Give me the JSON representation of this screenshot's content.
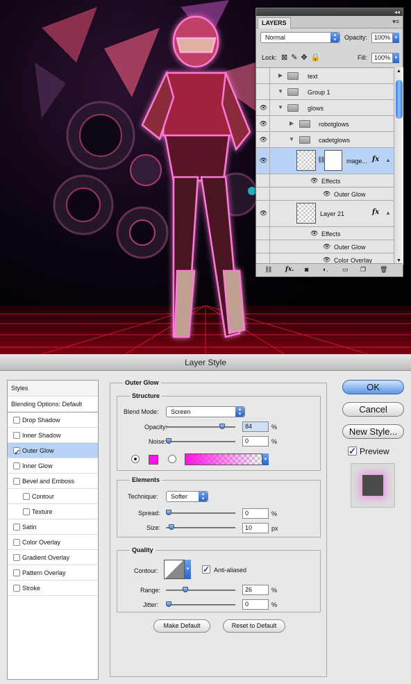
{
  "layers_panel": {
    "collapse_glyph": "◂◂",
    "tab": "LAYERS",
    "blend_mode": "Normal",
    "opacity_label": "Opacity:",
    "opacity_value": "100%",
    "lock_label": "Lock:",
    "fill_label": "Fill:",
    "fill_value": "100%",
    "rows": [
      {
        "name": "text",
        "visible": false
      },
      {
        "name": "Group 1",
        "visible": false
      },
      {
        "name": "glows",
        "visible": true
      },
      {
        "name": "robotglows",
        "visible": true
      },
      {
        "name": "cadetglows",
        "visible": true
      },
      {
        "name": "mage...",
        "visible": true,
        "fx": "fx"
      },
      {
        "name": "Effects"
      },
      {
        "name": "Outer Glow"
      },
      {
        "name": "Layer 21",
        "visible": true,
        "fx": "fx"
      },
      {
        "name": "Effects"
      },
      {
        "name": "Outer Glow"
      },
      {
        "name": "Color Overlay"
      }
    ]
  },
  "dialog": {
    "title": "Layer Style",
    "styles_header": "Styles",
    "blending_options": "Blending Options: Default",
    "styles": [
      {
        "label": "Drop Shadow",
        "checked": false
      },
      {
        "label": "Inner Shadow",
        "checked": false
      },
      {
        "label": "Outer Glow",
        "checked": true
      },
      {
        "label": "Inner Glow",
        "checked": false
      },
      {
        "label": "Bevel and Emboss",
        "checked": false
      },
      {
        "label": "Contour",
        "checked": false
      },
      {
        "label": "Texture",
        "checked": false
      },
      {
        "label": "Satin",
        "checked": false
      },
      {
        "label": "Color Overlay",
        "checked": false
      },
      {
        "label": "Gradient Overlay",
        "checked": false
      },
      {
        "label": "Pattern Overlay",
        "checked": false
      },
      {
        "label": "Stroke",
        "checked": false
      }
    ],
    "section_title": "Outer Glow",
    "structure": {
      "title": "Structure",
      "blend_mode_label": "Blend Mode:",
      "blend_mode": "Screen",
      "opacity_label": "Opacity:",
      "opacity": "84",
      "noise_label": "Noise:",
      "noise": "0",
      "percent": "%",
      "glow_color": "#ff14e8",
      "opacity_level": 0.84,
      "noise_level": 0
    },
    "elements": {
      "title": "Elements",
      "technique_label": "Technique:",
      "technique": "Softer",
      "spread_label": "Spread:",
      "spread": "0",
      "size_label": "Size:",
      "size": "10",
      "percent": "%",
      "px": "px",
      "spread_level": 0,
      "size_level": 0.04
    },
    "quality": {
      "title": "Quality",
      "contour_label": "Contour:",
      "anti_aliased_label": "Anti-aliased",
      "anti_aliased": true,
      "range_label": "Range:",
      "range": "26",
      "jitter_label": "Jitter:",
      "jitter": "0",
      "percent": "%",
      "range_level": 0.26,
      "jitter_level": 0
    },
    "make_default": "Make Default",
    "reset_default": "Reset to Default",
    "ok": "OK",
    "cancel": "Cancel",
    "new_style": "New Style...",
    "preview_label": "Preview",
    "preview": true
  }
}
